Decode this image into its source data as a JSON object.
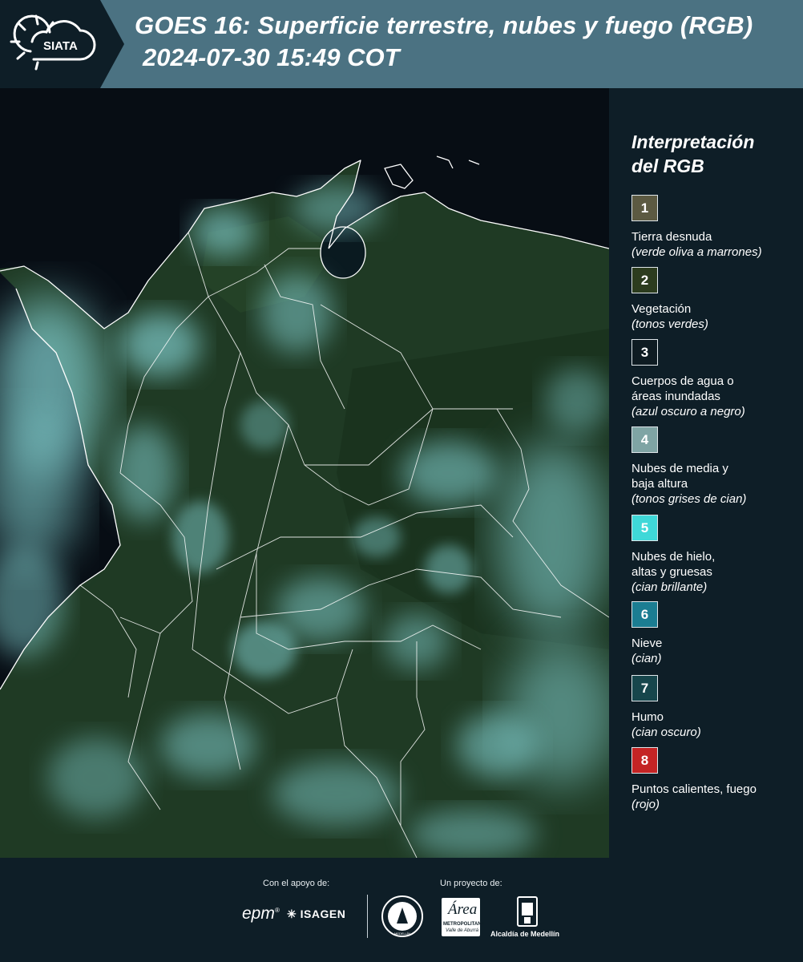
{
  "header": {
    "logo_text": "SIATA",
    "title_line1": "GOES 16: Superficie terrestre, nubes y fuego (RGB)",
    "title_line2": "2024-07-30 15:49 COT"
  },
  "legend": {
    "title_line1": "Interpretación",
    "title_line2": "del RGB",
    "items": [
      {
        "number": "1",
        "color": "#5c5a42",
        "lines": [
          "Tierra desnuda"
        ],
        "sub": "(verde oliva a marrones)"
      },
      {
        "number": "2",
        "color": "#2c3c1e",
        "lines": [
          "Vegetación"
        ],
        "sub": "(tonos verdes)"
      },
      {
        "number": "3",
        "color": "#0e1b22",
        "lines": [
          "Cuerpos de agua o",
          "áreas inundadas"
        ],
        "sub": "(azul oscuro a negro)"
      },
      {
        "number": "4",
        "color": "#7fa4a4",
        "lines": [
          "Nubes de media y",
          "baja altura"
        ],
        "sub": "(tonos grises de cian)"
      },
      {
        "number": "5",
        "color": "#3fd8d8",
        "lines": [
          "Nubes de hielo,",
          "altas y gruesas"
        ],
        "sub": "(cian brillante)"
      },
      {
        "number": "6",
        "color": "#1b7d92",
        "lines": [
          "Nieve"
        ],
        "sub": "(cian)"
      },
      {
        "number": "7",
        "color": "#17464c",
        "lines": [
          "Humo"
        ],
        "sub": "(cian oscuro)"
      },
      {
        "number": "8",
        "color": "#c42424",
        "lines": [
          "Puntos calientes, fuego"
        ],
        "sub": "(rojo)"
      }
    ]
  },
  "footer": {
    "support_caption": "Con el apoyo de:",
    "project_caption": "Un proyecto de:",
    "epm_logo": "epm",
    "isagen_logo": "ISAGEN",
    "area_logo": "Área",
    "area_sub1": "METROPOLITANA",
    "area_sub2": "Valle de Aburrá",
    "alcaldia_logo": "Alcaldía de Medellín",
    "univ_seal_text": "MEDELLÍN"
  },
  "colors": {
    "header_bg": "#4b7282",
    "logo_bg": "#0e1e27",
    "page_bg": "#0e1e27",
    "ocean": "#070d14",
    "land": "#1f3a24",
    "cloud": "#7ec9c9",
    "border_line": "#ffffff"
  }
}
